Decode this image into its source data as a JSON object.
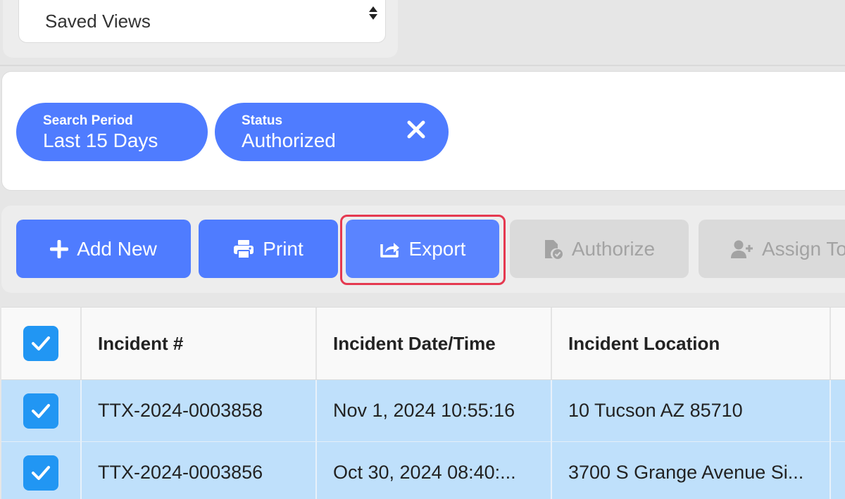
{
  "saved_views": {
    "label": "Saved Views"
  },
  "filters": [
    {
      "label": "Search Period",
      "value": "Last 15 Days",
      "removable": false
    },
    {
      "label": "Status",
      "value": "Authorized",
      "removable": true
    }
  ],
  "toolbar": {
    "add_new": "Add New",
    "print": "Print",
    "export": "Export",
    "authorize": "Authorize",
    "assign_to": "Assign To"
  },
  "table": {
    "columns": [
      "Incident #",
      "Incident Date/Time",
      "Incident Location"
    ],
    "rows": [
      {
        "incident": "TTX-2024-0003858",
        "datetime": "Nov 1, 2024 10:55:16",
        "location": "10 Tucson AZ 85710",
        "selected": true
      },
      {
        "incident": "TTX-2024-0003856",
        "datetime": "Oct 30, 2024 08:40:...",
        "location": "3700 S Grange Avenue Si...",
        "selected": true
      }
    ]
  },
  "colors": {
    "primary": "#4f7cff",
    "checkbox": "#2196f3",
    "selected_row": "#bfe0fb",
    "highlight": "#e53950"
  }
}
